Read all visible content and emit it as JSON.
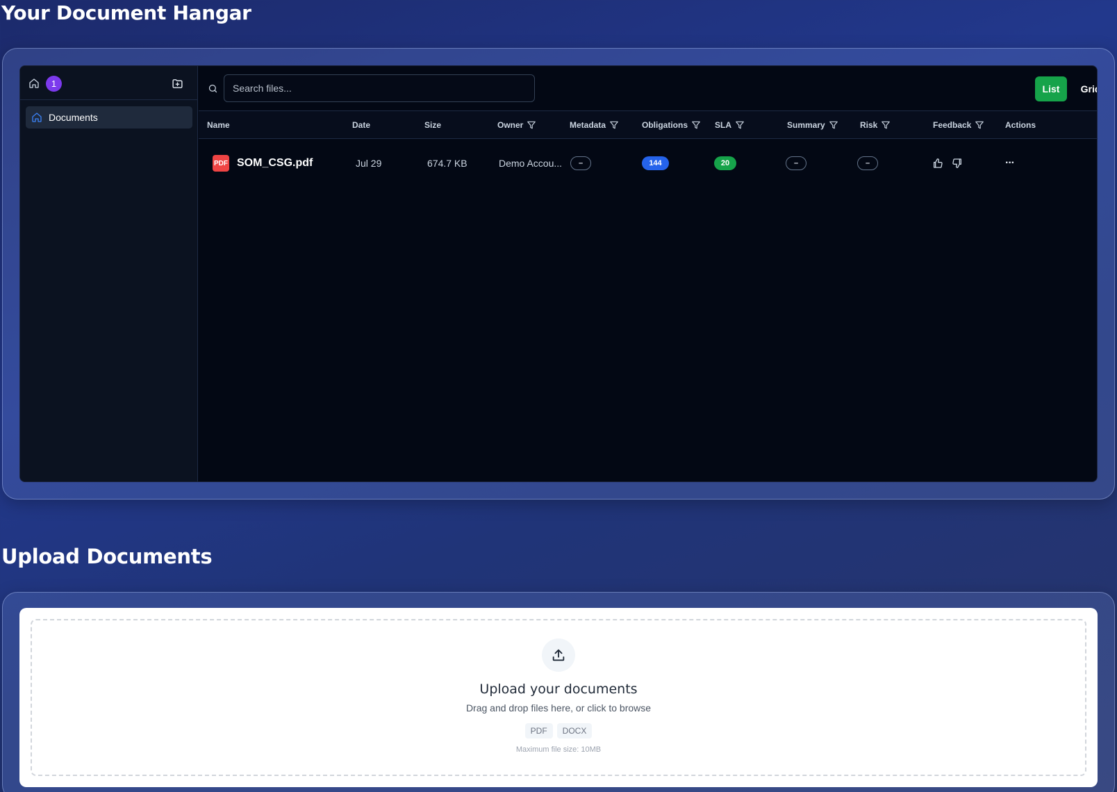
{
  "page": {
    "hangar_title": "Your Document Hangar",
    "upload_section_title": "Upload Documents"
  },
  "sidebar": {
    "home_icon": "home-icon",
    "file_count": "1",
    "new_folder_icon": "folder-plus-icon",
    "items": [
      {
        "label": "Documents",
        "icon": "home-icon",
        "active": true
      }
    ]
  },
  "toolbar": {
    "search_placeholder": "Search files...",
    "search_value": "",
    "view_list_label": "List",
    "view_grid_label": "Grid",
    "active_view": "List"
  },
  "table": {
    "columns": [
      {
        "label": "Name",
        "filter": false
      },
      {
        "label": "Date",
        "filter": false
      },
      {
        "label": "Size",
        "filter": false
      },
      {
        "label": "Owner",
        "filter": true
      },
      {
        "label": "Metadata",
        "filter": true
      },
      {
        "label": "Obligations",
        "filter": true
      },
      {
        "label": "SLA",
        "filter": true
      },
      {
        "label": "Summary",
        "filter": true
      },
      {
        "label": "Risk",
        "filter": true
      },
      {
        "label": "Feedback",
        "filter": true
      },
      {
        "label": "Actions",
        "filter": false
      }
    ],
    "rows": [
      {
        "type_badge": "PDF",
        "name": "SOM_CSG.pdf",
        "date": "Jul 29",
        "size": "674.7 KB",
        "owner": "Demo Accou...",
        "metadata": "–",
        "obligations": "144",
        "sla": "20",
        "summary": "–",
        "risk": "–",
        "actions": "···"
      }
    ]
  },
  "upload": {
    "heading": "Upload your documents",
    "subtext": "Drag and drop files here, or click to browse",
    "file_types": [
      "PDF",
      "DOCX"
    ],
    "max_size": "Maximum file size: 10MB"
  },
  "colors": {
    "accent_green": "#16a34a",
    "badge_purple": "#7c3aed",
    "obligations_blue": "#2563eb",
    "pdf_red": "#ef4444"
  }
}
